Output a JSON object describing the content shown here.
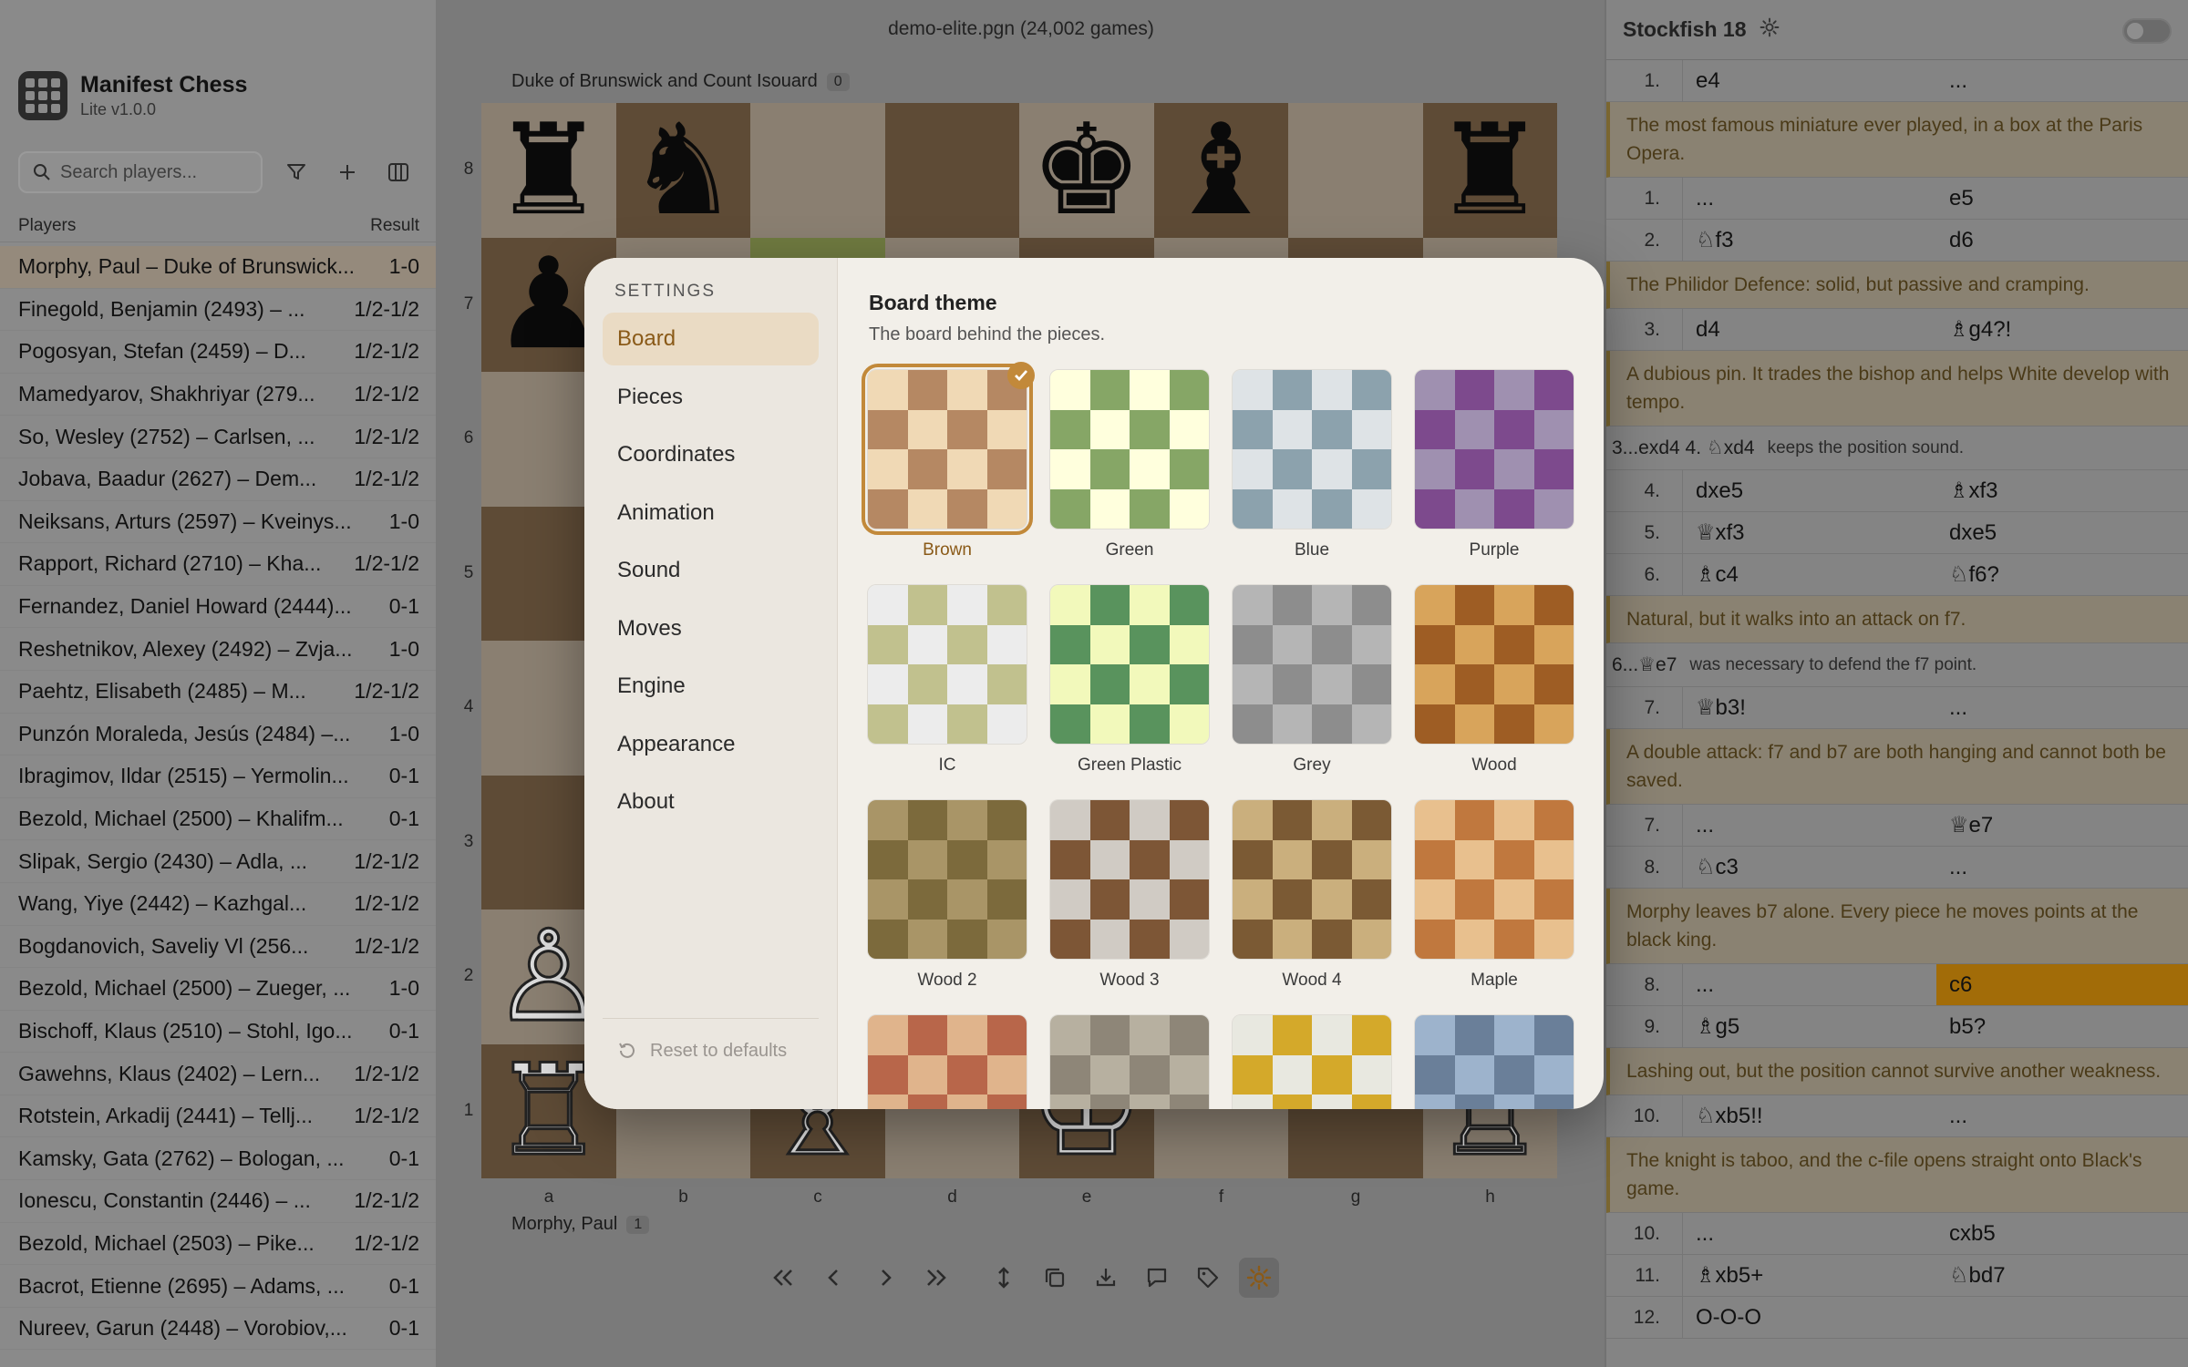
{
  "app": {
    "name": "Manifest Chess",
    "version": "Lite v1.0.0"
  },
  "search": {
    "placeholder": "Search players..."
  },
  "players_header": {
    "players": "Players",
    "result": "Result"
  },
  "players": [
    {
      "name": "Morphy, Paul – Duke of Brunswick...",
      "result": "1-0"
    },
    {
      "name": "Finegold, Benjamin (2493) – ...",
      "result": "1/2-1/2"
    },
    {
      "name": "Pogosyan, Stefan (2459) – D...",
      "result": "1/2-1/2"
    },
    {
      "name": "Mamedyarov, Shakhriyar (279...",
      "result": "1/2-1/2"
    },
    {
      "name": "So, Wesley (2752) – Carlsen, ...",
      "result": "1/2-1/2"
    },
    {
      "name": "Jobava, Baadur (2627) – Dem...",
      "result": "1/2-1/2"
    },
    {
      "name": "Neiksans, Arturs (2597) – Kveinys...",
      "result": "1-0"
    },
    {
      "name": "Rapport, Richard (2710) – Kha...",
      "result": "1/2-1/2"
    },
    {
      "name": "Fernandez, Daniel Howard (2444)...",
      "result": "0-1"
    },
    {
      "name": "Reshetnikov, Alexey (2492) – Zvja...",
      "result": "1-0"
    },
    {
      "name": "Paehtz, Elisabeth (2485) – M...",
      "result": "1/2-1/2"
    },
    {
      "name": "Punzón Moraleda, Jesús (2484) –...",
      "result": "1-0"
    },
    {
      "name": "Ibragimov, Ildar (2515) – Yermolin...",
      "result": "0-1"
    },
    {
      "name": "Bezold, Michael (2500) – Khalifm...",
      "result": "0-1"
    },
    {
      "name": "Slipak, Sergio (2430) – Adla, ...",
      "result": "1/2-1/2"
    },
    {
      "name": "Wang, Yiye (2442) – Kazhgal...",
      "result": "1/2-1/2"
    },
    {
      "name": "Bogdanovich, Saveliy Vl (256...",
      "result": "1/2-1/2"
    },
    {
      "name": "Bezold, Michael (2500) – Zueger, ...",
      "result": "1-0"
    },
    {
      "name": "Bischoff, Klaus (2510) – Stohl, Igo...",
      "result": "0-1"
    },
    {
      "name": "Gawehns, Klaus (2402) – Lern...",
      "result": "1/2-1/2"
    },
    {
      "name": "Rotstein, Arkadij (2441) – Tellj...",
      "result": "1/2-1/2"
    },
    {
      "name": "Kamsky, Gata (2762) – Bologan, ...",
      "result": "0-1"
    },
    {
      "name": "Ionescu, Constantin (2446) – ...",
      "result": "1/2-1/2"
    },
    {
      "name": "Bezold, Michael (2503) – Pike...",
      "result": "1/2-1/2"
    },
    {
      "name": "Bacrot, Etienne (2695) – Adams, ...",
      "result": "0-1"
    },
    {
      "name": "Nureev, Garun (2448) – Vorobiov,...",
      "result": "0-1"
    }
  ],
  "game": {
    "file_title": "demo-elite.pgn (24,002 games)",
    "black_player": "Duke of Brunswick and Count Isouard",
    "black_badge": "0",
    "white_player": "Morphy, Paul",
    "white_badge": "1"
  },
  "board": {
    "ranks": [
      "8",
      "7",
      "6",
      "5",
      "4",
      "3",
      "2",
      "1"
    ],
    "files": [
      "a",
      "b",
      "c",
      "d",
      "e",
      "f",
      "g",
      "h"
    ],
    "pieces": {
      "a8": "♜b",
      "b8": "♞b",
      "e8": "♚b",
      "f8": "♝b",
      "h8": "♜b",
      "a7": "♟b",
      "a2": "♙w",
      "a1": "♖w",
      "c1": "♗w",
      "e1": "♔w",
      "h1": "♖w"
    }
  },
  "engine": {
    "name": "Stockfish 18"
  },
  "moves": [
    {
      "type": "move",
      "num": "1.",
      "w": "e4",
      "b": "..."
    },
    {
      "type": "comment",
      "text": "The most famous miniature ever played, in a box at the Paris Opera."
    },
    {
      "type": "move",
      "num": "1.",
      "w": "...",
      "b": "e5"
    },
    {
      "type": "move",
      "num": "2.",
      "w": "♘f3",
      "b": "d6"
    },
    {
      "type": "comment",
      "text": "The Philidor Defence: solid, but passive and cramping."
    },
    {
      "type": "move",
      "num": "3.",
      "w": "d4",
      "b": "♗g4?!"
    },
    {
      "type": "comment",
      "text": "A dubious pin. It trades the bishop and helps White develop with tempo."
    },
    {
      "type": "variation",
      "line": "3...exd4  4. ♘xd4",
      "note": "keeps the position sound."
    },
    {
      "type": "move",
      "num": "4.",
      "w": "dxe5",
      "b": "♗xf3"
    },
    {
      "type": "move",
      "num": "5.",
      "w": "♕xf3",
      "b": "dxe5"
    },
    {
      "type": "move",
      "num": "6.",
      "w": "♗c4",
      "b": "♘f6?"
    },
    {
      "type": "comment",
      "text": "Natural, but it walks into an attack on f7."
    },
    {
      "type": "variation",
      "line": "6...♕e7",
      "note": "was necessary to defend the f7 point."
    },
    {
      "type": "move",
      "num": "7.",
      "w": "♕b3!",
      "b": "..."
    },
    {
      "type": "comment",
      "text": "A double attack: f7 and b7 are both hanging and cannot both be saved."
    },
    {
      "type": "move",
      "num": "7.",
      "w": "...",
      "b": "♕e7"
    },
    {
      "type": "move",
      "num": "8.",
      "w": "♘c3",
      "b": "..."
    },
    {
      "type": "comment",
      "text": "Morphy leaves b7 alone. Every piece he moves points at the black king."
    },
    {
      "type": "move",
      "num": "8.",
      "w": "...",
      "b": "c6",
      "current": true
    },
    {
      "type": "move",
      "num": "9.",
      "w": "♗g5",
      "b": "b5?"
    },
    {
      "type": "comment",
      "text": "Lashing out, but the position cannot survive another weakness."
    },
    {
      "type": "move",
      "num": "10.",
      "w": "♘xb5!!",
      "b": "..."
    },
    {
      "type": "comment",
      "text": "The knight is taboo, and the c-file opens straight onto Black's game."
    },
    {
      "type": "move",
      "num": "10.",
      "w": "...",
      "b": "cxb5"
    },
    {
      "type": "move",
      "num": "11.",
      "w": "♗xb5+",
      "b": "♘bd7"
    },
    {
      "type": "move",
      "num": "12.",
      "w": "O-O-O",
      "b": ""
    }
  ],
  "settings": {
    "title": "SETTINGS",
    "nav": [
      "Board",
      "Pieces",
      "Coordinates",
      "Animation",
      "Sound",
      "Moves",
      "Engine",
      "Appearance",
      "About"
    ],
    "active_nav": 0,
    "reset_label": "Reset to defaults",
    "section_title": "Board theme",
    "section_sub": "The board behind the pieces.",
    "selected_theme": 0,
    "themes": [
      {
        "label": "Brown",
        "light": "#f0d9b5",
        "dark": "#b58863"
      },
      {
        "label": "Green",
        "light": "#ffffdd",
        "dark": "#86a666"
      },
      {
        "label": "Blue",
        "light": "#dee3e6",
        "dark": "#8ca2ad"
      },
      {
        "label": "Purple",
        "light": "#9f90b0",
        "dark": "#7d4a8d"
      },
      {
        "label": "IC",
        "light": "#ececec",
        "dark": "#c1c18e"
      },
      {
        "label": "Green Plastic",
        "light": "#f2f9bb",
        "dark": "#59935d"
      },
      {
        "label": "Grey",
        "light": "#b5b5b5",
        "dark": "#8d8d8d"
      },
      {
        "label": "Wood",
        "light": "#d8a45b",
        "dark": "#9e5d24"
      },
      {
        "label": "Wood 2",
        "light": "#a99567",
        "dark": "#7c6a3c"
      },
      {
        "label": "Wood 3",
        "light": "#d0cbc4",
        "dark": "#7d5636"
      },
      {
        "label": "Wood 4",
        "light": "#caaf7d",
        "dark": "#7b5a34"
      },
      {
        "label": "Maple",
        "light": "#e8c08e",
        "dark": "#c0783e"
      },
      {
        "label": "",
        "light": "#e0b48c",
        "dark": "#b8664a"
      },
      {
        "label": "",
        "light": "#b7b0a0",
        "dark": "#8e8678"
      },
      {
        "label": "",
        "light": "#e8e8e0",
        "dark": "#d4a92a"
      },
      {
        "label": "",
        "light": "#9db3cc",
        "dark": "#6a7f99"
      }
    ]
  }
}
